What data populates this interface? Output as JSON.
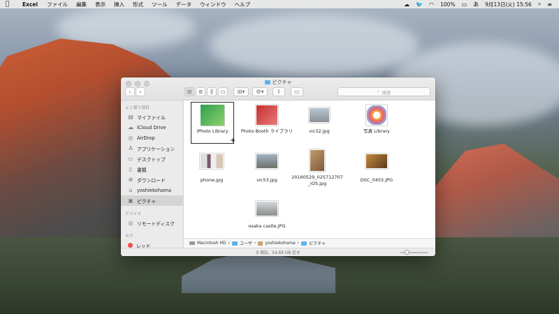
{
  "menubar": {
    "apple_icon": "apple-icon",
    "app": "Excel",
    "items": [
      "ファイル",
      "編集",
      "表示",
      "挿入",
      "形式",
      "ツール",
      "データ",
      "ウィンドウ",
      "ヘルプ"
    ],
    "battery": "100%",
    "date_time": "9月13日(火)  15:56"
  },
  "window": {
    "title": "ピクチャ",
    "search_placeholder": "検索"
  },
  "sidebar": {
    "favorites_header": "よく使う項目",
    "favorites": [
      {
        "label": "マイファイル",
        "icon": "all-files-icon"
      },
      {
        "label": "iCloud Drive",
        "icon": "cloud-icon"
      },
      {
        "label": "AirDrop",
        "icon": "airdrop-icon"
      },
      {
        "label": "アプリケーション",
        "icon": "applications-icon"
      },
      {
        "label": "デスクトップ",
        "icon": "desktop-icon"
      },
      {
        "label": "書類",
        "icon": "documents-icon"
      },
      {
        "label": "ダウンロード",
        "icon": "downloads-icon"
      },
      {
        "label": "yoshiekohama",
        "icon": "home-icon"
      },
      {
        "label": "ピクチャ",
        "icon": "pictures-icon"
      }
    ],
    "devices_header": "デバイス",
    "devices": [
      {
        "label": "リモートディスク",
        "icon": "remote-disc-icon"
      }
    ],
    "tags_header": "タグ",
    "tags": [
      {
        "label": "レッド",
        "color": "#f34a4a"
      }
    ]
  },
  "files": [
    {
      "name": "iPhoto Library",
      "kind": "iphoto-library"
    },
    {
      "name": "Photo Booth ライブラリ",
      "kind": "photobooth-library"
    },
    {
      "name": "vic32.jpg",
      "kind": "photo"
    },
    {
      "name": "写真 Library",
      "kind": "photos-library"
    },
    {
      "name": "phone.jpg",
      "kind": "photo"
    },
    {
      "name": "vic53.jpg",
      "kind": "photo"
    },
    {
      "name": "20160529_025712707_iOS.jpg",
      "kind": "photo"
    },
    {
      "name": "DSC_0455.JPG",
      "kind": "photo"
    },
    {
      "name": "osaka castle.JPG",
      "kind": "photo"
    }
  ],
  "pathbar": [
    "Macintosh HD",
    "ユーザ",
    "yoshiekohama",
    "ピクチャ"
  ],
  "status": "9 項目、54.69 GB 空き"
}
